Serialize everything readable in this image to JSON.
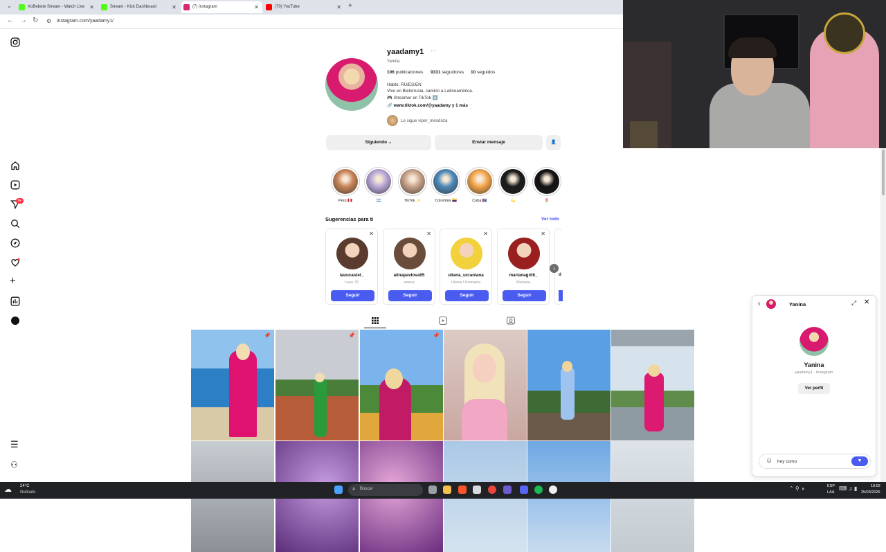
{
  "browser": {
    "tabs": [
      {
        "label": "XoBebote Stream - Watch Live",
        "color": "#53fc18",
        "active": false
      },
      {
        "label": "Stream - Kick Dashboard",
        "color": "#53fc18",
        "active": false
      },
      {
        "label": "(7) Instagram",
        "color": "#d62976",
        "active": true
      },
      {
        "label": "(70) YouTube",
        "color": "#ff0000",
        "active": false
      }
    ],
    "url": "instagram.com/yaadamy1/"
  },
  "profile": {
    "username": "yaadamy1",
    "more": "···",
    "fullname": "Yanina",
    "stats": {
      "posts_num": "106",
      "posts_label": "publicaciones",
      "followers_num": "9331",
      "followers_label": "seguidores",
      "following_num": "10",
      "following_label": "seguidos"
    },
    "bio": [
      "Hablo: RU/ES/EN",
      "Vivo en Bielorrusia, camino a Latinoamérica.",
      "🎮 Streamer en TikTok ⬇️"
    ],
    "link": "www.tiktok.com/@yaadamy y 1 más",
    "followed_by": "Le sigue viper_mendoza",
    "btn_following": "Siguiendo ⌄",
    "btn_message": "Enviar mensaje"
  },
  "highlights": [
    {
      "label": "Perú 🇵🇪",
      "bg": "#c8855a"
    },
    {
      "label": "🇦🇷",
      "bg": "#b9a7d8"
    },
    {
      "label": "TikTok ✨",
      "bg": "#c9a28a"
    },
    {
      "label": "Colombia 🇨🇴",
      "bg": "#4f8ab8"
    },
    {
      "label": "Cuba 🇨🇺",
      "bg": "#f3a54b"
    },
    {
      "label": "💫",
      "bg": "#1a1a1a"
    },
    {
      "label": "🌷",
      "bg": "#111111"
    }
  ],
  "suggestions": {
    "title": "Sugerencias para ti",
    "see_all": "Ver todo",
    "follow_label": "Seguir",
    "items": [
      {
        "name": "lauucastel_",
        "sub": "Lauu 🤍",
        "bg": "#5a3b2e"
      },
      {
        "name": "alinapavlova05",
        "sub": "алина",
        "bg": "#6a4c3a"
      },
      {
        "name": "uliana_ucraniana",
        "sub": "Uliana Ucraniana",
        "bg": "#f2d13d"
      },
      {
        "name": "marianagrilli_",
        "sub": "Mariana",
        "bg": "#9a2020"
      }
    ]
  },
  "dm": {
    "header_name": "Yanina",
    "name": "Yanina",
    "sub": "yaadamy1 · Instagram",
    "view_profile": "Ver perfil",
    "input_value": "hey como"
  },
  "taskbar": {
    "temp": "24°C",
    "weather": "Nublado",
    "search_placeholder": "Buscar",
    "lang1": "ESP",
    "lang2": "LAA",
    "time": "19:52",
    "date": "25/03/2026"
  },
  "icons": [
    "instagram-icon",
    "home-icon",
    "reels-icon",
    "messages-icon",
    "search-icon",
    "explore-icon",
    "heart-icon",
    "create-icon",
    "dashboard-icon",
    "profile-icon",
    "menu-icon",
    "threads-icon"
  ]
}
